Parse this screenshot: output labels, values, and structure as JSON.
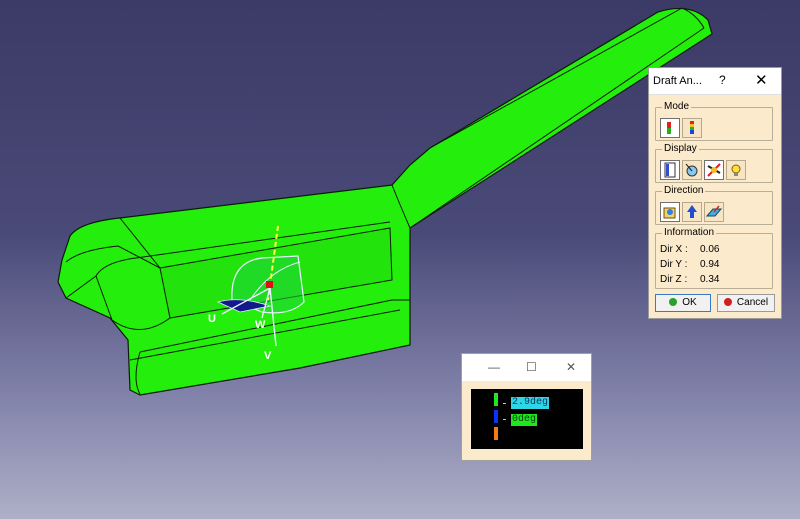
{
  "viewport": {
    "axis_u": "U",
    "axis_v": "V",
    "axis_w": "W",
    "part_color": "#24ee0c",
    "background_top": "#3c3a66",
    "background_bottom": "#aeb0c8"
  },
  "draft_dialog": {
    "title": "Draft An...",
    "help": "?",
    "close": "✕",
    "mode_label": "Mode",
    "display_label": "Display",
    "direction_label": "Direction",
    "information_label": "Information",
    "info": [
      {
        "label": "Dir X :",
        "value": "0.06"
      },
      {
        "label": "Dir Y :",
        "value": "0.94"
      },
      {
        "label": "Dir Z :",
        "value": "0.34"
      }
    ],
    "ok_label": "OK",
    "cancel_label": "Cancel"
  },
  "legend_window": {
    "minimize": "—",
    "maximize": "☐",
    "close": "✕",
    "entries": [
      {
        "value": "2.9deg",
        "swatch": "#1fe81f",
        "bg": "#2fd7e6"
      },
      {
        "value": "0deg",
        "swatch": "#1030ff",
        "bg": "#1fe81f"
      }
    ],
    "extra_swatch": "#f07d1a"
  }
}
